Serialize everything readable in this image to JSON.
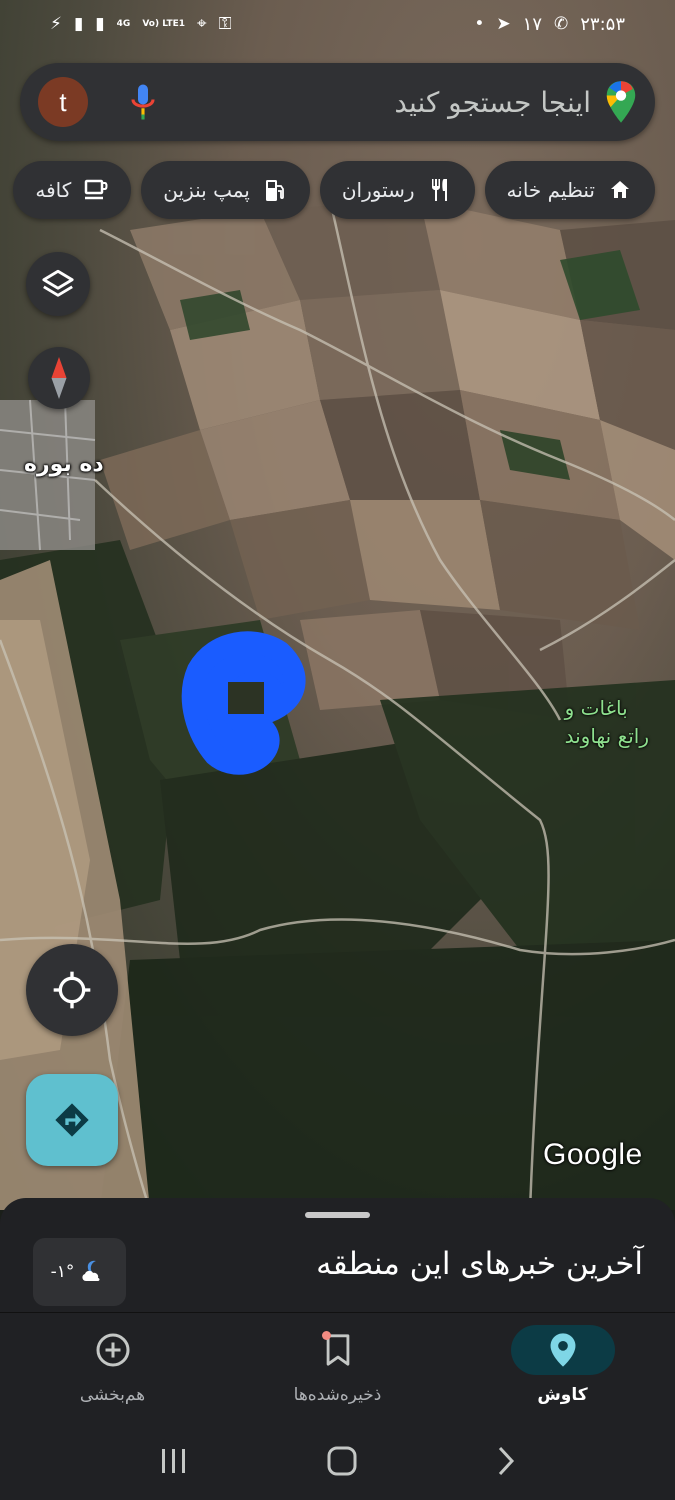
{
  "status_bar": {
    "time": "۲۳:۵۳",
    "network": "4G",
    "volte": "Vo) LTE1",
    "notification_count": "۱۷"
  },
  "search": {
    "placeholder": "اینجا جستجو کنید",
    "avatar_letter": "t"
  },
  "chips": [
    {
      "label": "تنظیم خانه",
      "icon": "home-icon"
    },
    {
      "label": "رستوران",
      "icon": "restaurant-icon"
    },
    {
      "label": "پمپ بنزین",
      "icon": "gas-station-icon"
    },
    {
      "label": "کافه",
      "icon": "cafe-icon"
    }
  ],
  "map": {
    "place_label": "ده بوره",
    "park_label_line1": "باغات و",
    "park_label_line2": "راتع نهاوند",
    "attribution": "Google",
    "marker_color": "#1a5cff"
  },
  "sheet": {
    "title": "آخرین خبرهای این منطقه",
    "weather_temp": "-۱°"
  },
  "bottom_nav": {
    "items": [
      {
        "label": "کاوش",
        "icon": "location-pin-icon",
        "active": true
      },
      {
        "label": "ذخیره‌شده‌ها",
        "icon": "bookmark-icon",
        "active": false
      },
      {
        "label": "هم‌بخشی",
        "icon": "add-circle-icon",
        "active": false
      }
    ]
  },
  "colors": {
    "accent": "#5fc0cf",
    "surface": "#303134",
    "sheet": "#202124",
    "active_nav": "#0c3b45"
  }
}
